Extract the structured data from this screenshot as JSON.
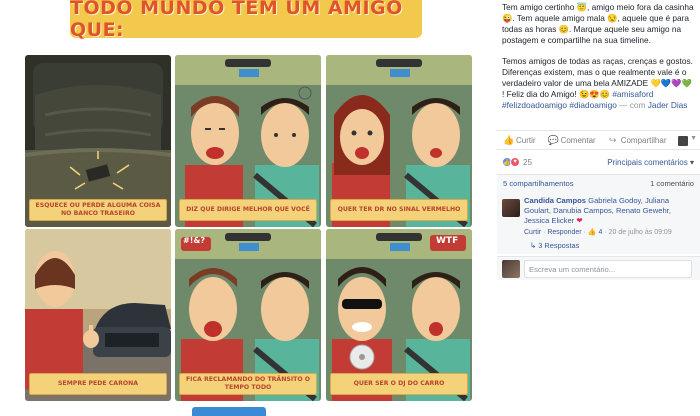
{
  "photo": {
    "title": "TODO MUNDO TEM UM AMIGO QUE:",
    "panels": [
      {
        "caption": "Esquece ou perde alguma coisa no banco traseiro"
      },
      {
        "caption": "Diz que dirige melhor que você"
      },
      {
        "caption": "Quer ter DR no sinal vermelho"
      },
      {
        "caption": "Sempre pede carona"
      },
      {
        "caption": "Fica reclamando do trânsito o tempo todo"
      },
      {
        "caption": "Quer ser o DJ do carro"
      }
    ],
    "bubbles": {
      "angry": "#!&?",
      "wtf": "WTF"
    }
  },
  "post": {
    "paragraph1": "Tem amigo certinho 😇, amigo meio fora da casinha 😜. Tem aquele amigo mala 😒, aquele que é para todas as horas 😊. Marque aquele seu amigo na postagem e compartilhe na sua timeline.",
    "paragraph2_a": "Temos amigos de todas as raças, crenças e gostos. Diferenças existem, mas o que realmente vale é o verdadeiro valor de uma bela AMIZADE 💛💙💜💚 ! Feliz dia do Amigo! 😉😍😊 ",
    "hashtag1": "#amisaford",
    "hashtag2": "#felizdoadoamigo",
    "hashtag3": "#diadoamigo",
    "with_text": " — com ",
    "tagged": "Jader Dias"
  },
  "actions": {
    "like": "Curtir",
    "comment": "Comentar",
    "share": "Compartilhar"
  },
  "reactions": {
    "count": "25",
    "sort_label": "Principais comentários",
    "sort_caret": "▾"
  },
  "stats": {
    "shares": "5 compartilhamentos",
    "comments": "1 comentário"
  },
  "comment": {
    "author": "Candida Campos",
    "mentions": "Gabriela Godoy, Juliana Goulart, Danubia Campos, Renato Gewehr, Jessica Elicker",
    "heart": "❤",
    "like": "Curtir",
    "reply": "Responder",
    "likes_count": "4",
    "date": "20 de julho às 09:09",
    "replies": "3 Respostas"
  },
  "composer": {
    "placeholder": "Escreva um comentário..."
  },
  "colors": {
    "link": "#365899",
    "banner": "#f2c94c",
    "title_text": "#e0542c",
    "caption_bg": "#f3d27a"
  }
}
